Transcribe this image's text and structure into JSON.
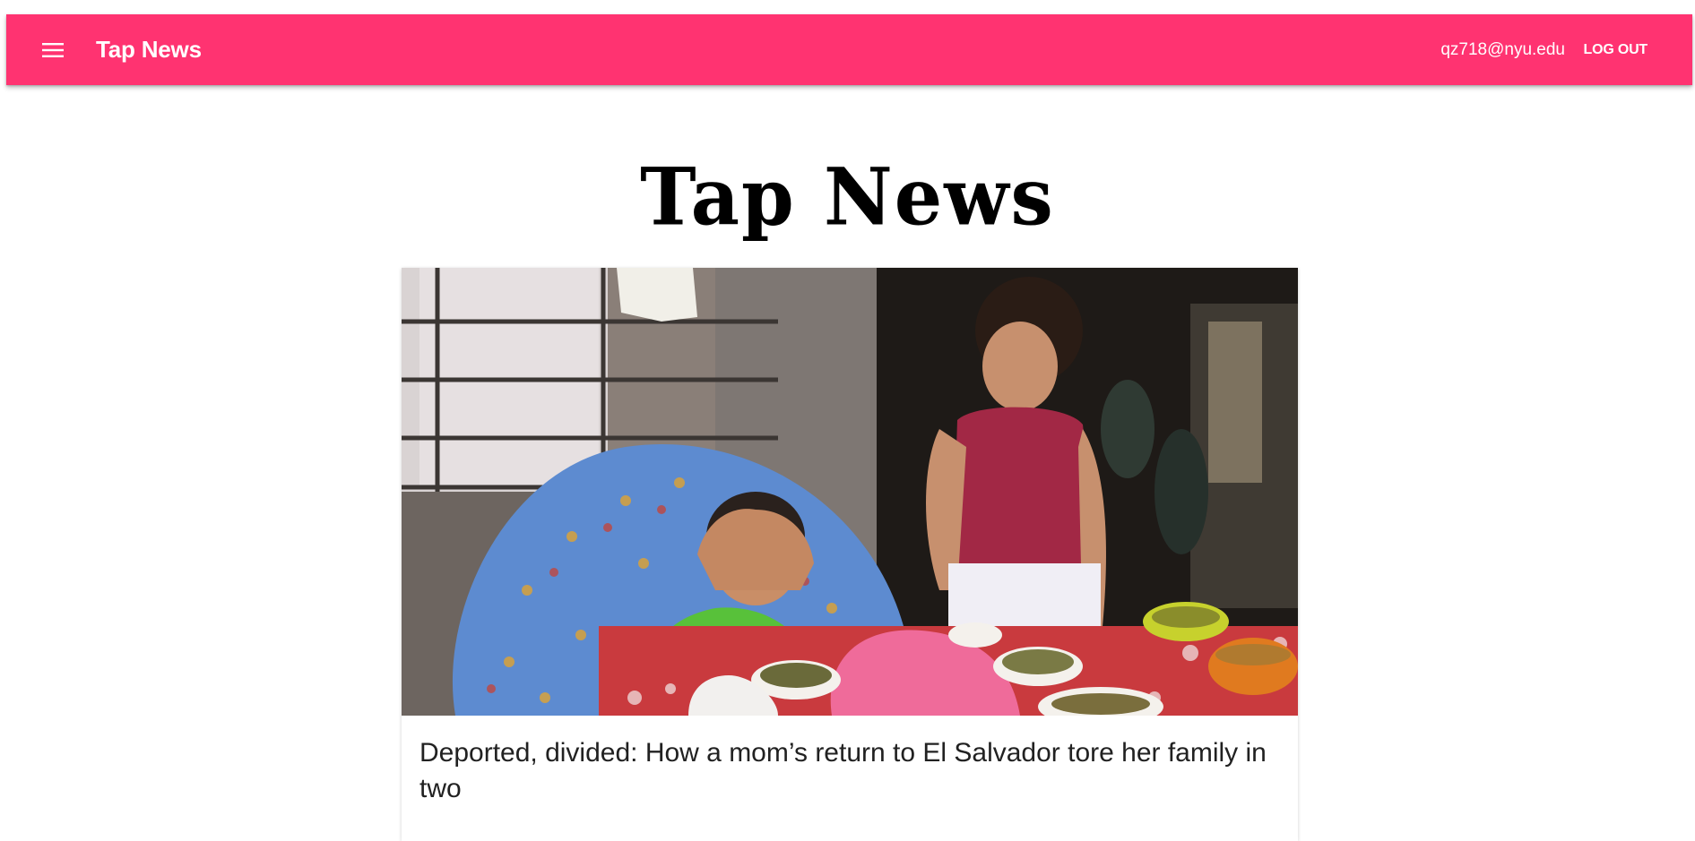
{
  "app_bar": {
    "menu_icon": "hamburger-menu-icon",
    "title": "Tap News",
    "user_email": "qz718@nyu.edu",
    "logout_label": "LOG OUT",
    "color": "#ff3371"
  },
  "masthead": {
    "text": "Tap News"
  },
  "news": [
    {
      "title": "Deported, divided: How a mom’s return to El Salvador tore her family in two"
    }
  ]
}
